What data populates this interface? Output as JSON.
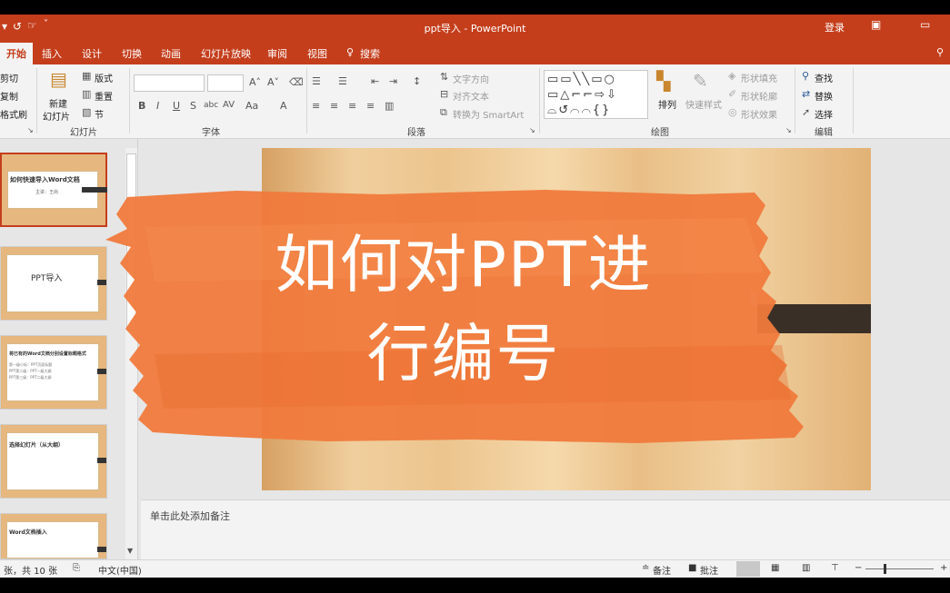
{
  "window": {
    "title": "ppt导入 - PowerPoint",
    "login": "登录"
  },
  "tabs": [
    "开始",
    "插入",
    "设计",
    "切换",
    "动画",
    "幻灯片放映",
    "审阅",
    "视图",
    "搜索"
  ],
  "ribbon": {
    "clipboard": {
      "cut": "剪切",
      "copy": "复制",
      "format": "格式刷"
    },
    "slides": {
      "new_1": "新建",
      "new_2": "幻灯片",
      "layout": "版式",
      "reset": "重置",
      "section": "节",
      "group": "幻灯片"
    },
    "font": {
      "group": "字体"
    },
    "paragraph": {
      "text_direction": "文字方向",
      "align_text": "对齐文本",
      "smartart": "转换为 SmartArt",
      "group": "段落"
    },
    "drawing": {
      "arrange": "排列",
      "quick_styles": "快速样式",
      "shape_fill": "形状填充",
      "shape_outline": "形状轮廓",
      "shape_effects": "形状效果",
      "group": "绘图"
    },
    "editing": {
      "find": "查找",
      "replace": "替换",
      "select": "选择",
      "group": "编辑"
    }
  },
  "thumbnails": [
    {
      "title": "如何快速导入Word文档",
      "subtitle": "主讲：王尚",
      "selected": true
    },
    {
      "title": "PPT导入",
      "selected": false
    },
    {
      "title": "将已有的Word文档分别设置标题格式",
      "lines": [
        "第一级小标：PPT页面标题",
        "PPT第二级：PPT一级大纲",
        "PPT第三级：PPT二级大纲"
      ],
      "selected": false
    },
    {
      "title": "选择幻灯片（从大纲）",
      "selected": false
    },
    {
      "title": "Word文档插入",
      "selected": false
    }
  ],
  "overlay": {
    "headline_1": "如何对PPT进",
    "headline_2": "行编号"
  },
  "notes": {
    "placeholder": "单击此处添加备注"
  },
  "status": {
    "slide_count": "张，共 10 张",
    "language": "中文(中国)",
    "notes_btn": "备注",
    "comments_btn": "批注"
  },
  "colors": {
    "accent": "#c43e1c",
    "brush": "#f07a3c",
    "slide_wood": "#ecc48d"
  }
}
